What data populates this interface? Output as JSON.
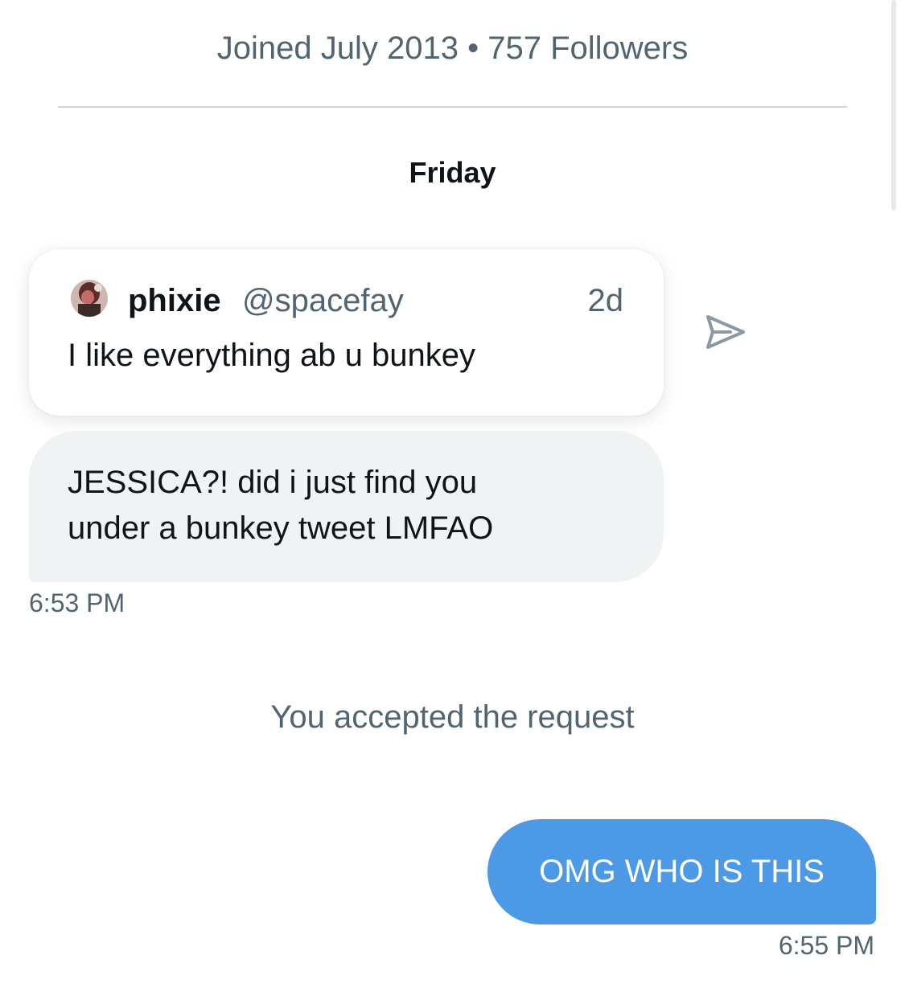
{
  "profile": {
    "meta": "Joined July 2013 • 757 Followers"
  },
  "conversation": {
    "day_label": "Friday",
    "quoted_tweet": {
      "name": "phixie",
      "handle": "@spacefay",
      "time": "2d",
      "text": "I like everything ab u bunkey",
      "avatar_icon": "user-avatar"
    },
    "share_icon": "send-icon",
    "received_message": {
      "lines": [
        "JESSICA?! did i just find you",
        "under a bunkey tweet LMFAO"
      ],
      "time": "6:53 PM"
    },
    "system_note": "You accepted the request",
    "sent_message": {
      "text": "OMG WHO IS THIS",
      "time": "6:55 PM"
    }
  },
  "colors": {
    "sent_bubble": "#4c99e6",
    "received_bubble": "#eff3f4",
    "secondary_text": "#536471",
    "primary_text": "#0f1419",
    "divider": "#cfd9de"
  }
}
